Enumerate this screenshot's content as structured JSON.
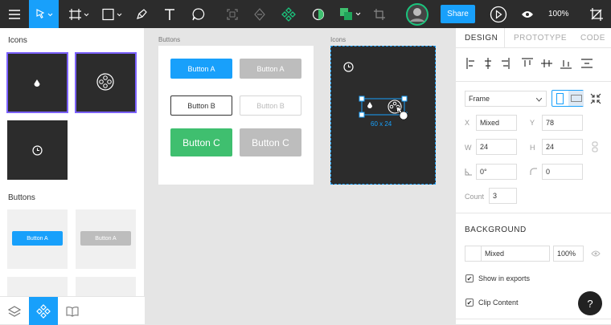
{
  "toolbar": {
    "share_label": "Share",
    "zoom": "100%"
  },
  "left_panel": {
    "icons_heading": "Icons",
    "buttons_heading": "Buttons",
    "thumb_button_label_1": "Button A",
    "thumb_button_label_2": "Button A"
  },
  "canvas": {
    "buttons_frame_label": "Buttons",
    "icons_frame_label": "Icons",
    "buttons": [
      {
        "label": "Button A"
      },
      {
        "label": "Button A"
      },
      {
        "label": "Button B"
      },
      {
        "label": "Button B"
      },
      {
        "label": "Button C"
      },
      {
        "label": "Button C"
      }
    ],
    "selection_size": "60 x 24"
  },
  "right_panel": {
    "tabs": [
      {
        "label": "DESIGN"
      },
      {
        "label": "PROTOTYPE"
      },
      {
        "label": "CODE"
      }
    ],
    "frame_select": "Frame",
    "x_label": "X",
    "x_value": "Mixed",
    "y_label": "Y",
    "y_value": "78",
    "w_label": "W",
    "w_value": "24",
    "h_label": "H",
    "h_value": "24",
    "rotation_value": "0°",
    "radius_value": "0",
    "count_label": "Count",
    "count_value": "3",
    "background_heading": "BACKGROUND",
    "bg_value": "Mixed",
    "bg_opacity": "100%",
    "show_in_exports": "Show in exports",
    "clip_content": "Clip Content",
    "check_mark": "✔"
  },
  "help_label": "?",
  "colors": {
    "accent": "#18a0fb",
    "toolbar": "#2c2c2c",
    "selection": "#7b61ff",
    "green": "#3fbf6f",
    "teal": "#1bc47d"
  }
}
